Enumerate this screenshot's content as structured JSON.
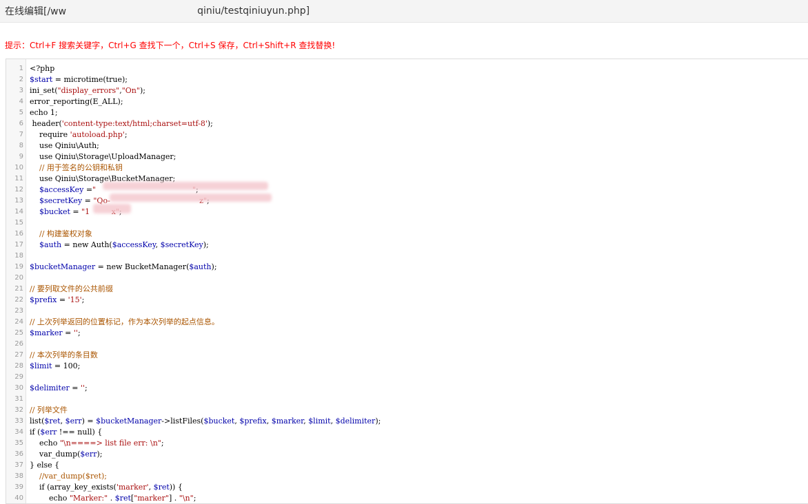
{
  "window": {
    "title_prefix": "在线编辑[/ww",
    "title_suffix": "qiniu/testqiniuyun.php]"
  },
  "hint": "提示：Ctrl+F 搜索关键字，Ctrl+G 查找下一个，Ctrl+S 保存，Ctrl+Shift+R 查找替换!",
  "code_lines": [
    "<?php",
    "$start = microtime(true);",
    "ini_set(\"display_errors\",\"On\");",
    "error_reporting(E_ALL);",
    "echo 1;",
    " header('content-type:text/html;charset=utf-8');",
    "    require 'autoload.php';",
    "    use Qiniu\\Auth;",
    "    use Qiniu\\Storage\\UploadManager;",
    "    // 用于签名的公钥和私钥",
    "    use Qiniu\\Storage\\BucketManager;",
    "    $accessKey =\"                                        \";",
    "    $secretKey = \"Qo-                                     z\";",
    "    $bucket = \"1         x\";",
    "",
    "    // 构建鉴权对象",
    "    $auth = new Auth($accessKey, $secretKey);",
    "",
    "$bucketManager = new BucketManager($auth);",
    "",
    "// 要列取文件的公共前缀",
    "$prefix = '15';",
    "",
    "// 上次列举返回的位置标记，作为本次列举的起点信息。",
    "$marker = '';",
    "",
    "// 本次列举的条目数",
    "$limit = 100;",
    "",
    "$delimiter = '';",
    "",
    "// 列举文件",
    "list($ret, $err) = $bucketManager->listFiles($bucket, $prefix, $marker, $limit, $delimiter);",
    "if ($err !== null) {",
    "    echo \"\\n====> list file err: \\n\";",
    "    var_dump($err);",
    "} else {",
    "    //var_dump($ret);",
    "    if (array_key_exists('marker', $ret)) {",
    "        echo \"Marker:\" . $ret[\"marker\"] . \"\\n\";"
  ]
}
